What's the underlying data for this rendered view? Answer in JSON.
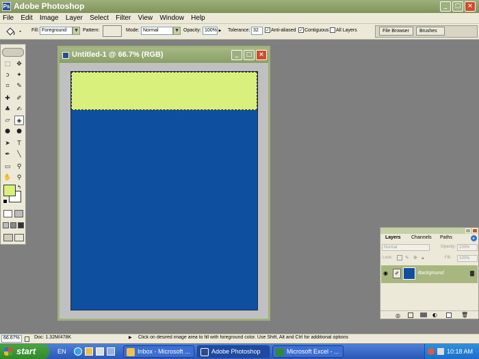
{
  "app": {
    "title": "Adobe Photoshop"
  },
  "menu": [
    "File",
    "Edit",
    "Image",
    "Layer",
    "Select",
    "Filter",
    "View",
    "Window",
    "Help"
  ],
  "options": {
    "fill_label": "Fill:",
    "fill_value": "Foreground",
    "pattern_label": "Pattern:",
    "mode_label": "Mode:",
    "mode_value": "Normal",
    "opacity_label": "Opacity:",
    "opacity_value": "100%",
    "tolerance_label": "Tolerance:",
    "tolerance_value": "32",
    "anti_aliased_label": "Anti-aliased",
    "anti_aliased_checked": true,
    "contiguous_label": "Contiguous",
    "contiguous_checked": true,
    "all_layers_label": "All Layers",
    "all_layers_checked": false,
    "tabs": [
      "File Browser",
      "Brushes"
    ]
  },
  "document": {
    "title": "Untitled-1 @ 66.7% (RGB)",
    "canvas_color": "#0f4fa0",
    "selection_fill_color": "#daf07c"
  },
  "colors": {
    "foreground": "#daf07c",
    "background": "#ffffff"
  },
  "layers_palette": {
    "tabs": [
      "Layers",
      "Channels",
      "Paths"
    ],
    "blend_mode": "Normal",
    "opacity_label": "Opacity:",
    "opacity_value": "100%",
    "lock_label": "Lock:",
    "fill_label": "Fill:",
    "fill_value": "100%",
    "layers": [
      {
        "name": "Background",
        "visible": true
      }
    ]
  },
  "status": {
    "zoom": "66.67%",
    "doc_info": "Doc: 1.32M/478K",
    "hint": "Click on desired image area to fill with foreground color.  Use Shift, Alt and Ctrl for additional options"
  },
  "taskbar": {
    "start_label": "start",
    "lang": "EN",
    "tasks": [
      {
        "label": "Inbox - Microsoft ...",
        "icon_color": "#f2c14a",
        "active": false
      },
      {
        "label": "Adobe Photoshop",
        "icon_color": "#2b4c8e",
        "active": true
      },
      {
        "label": "Microsoft Excel - ...",
        "icon_color": "#2e8b3a",
        "active": false
      }
    ],
    "clock": "10:18 AM"
  }
}
